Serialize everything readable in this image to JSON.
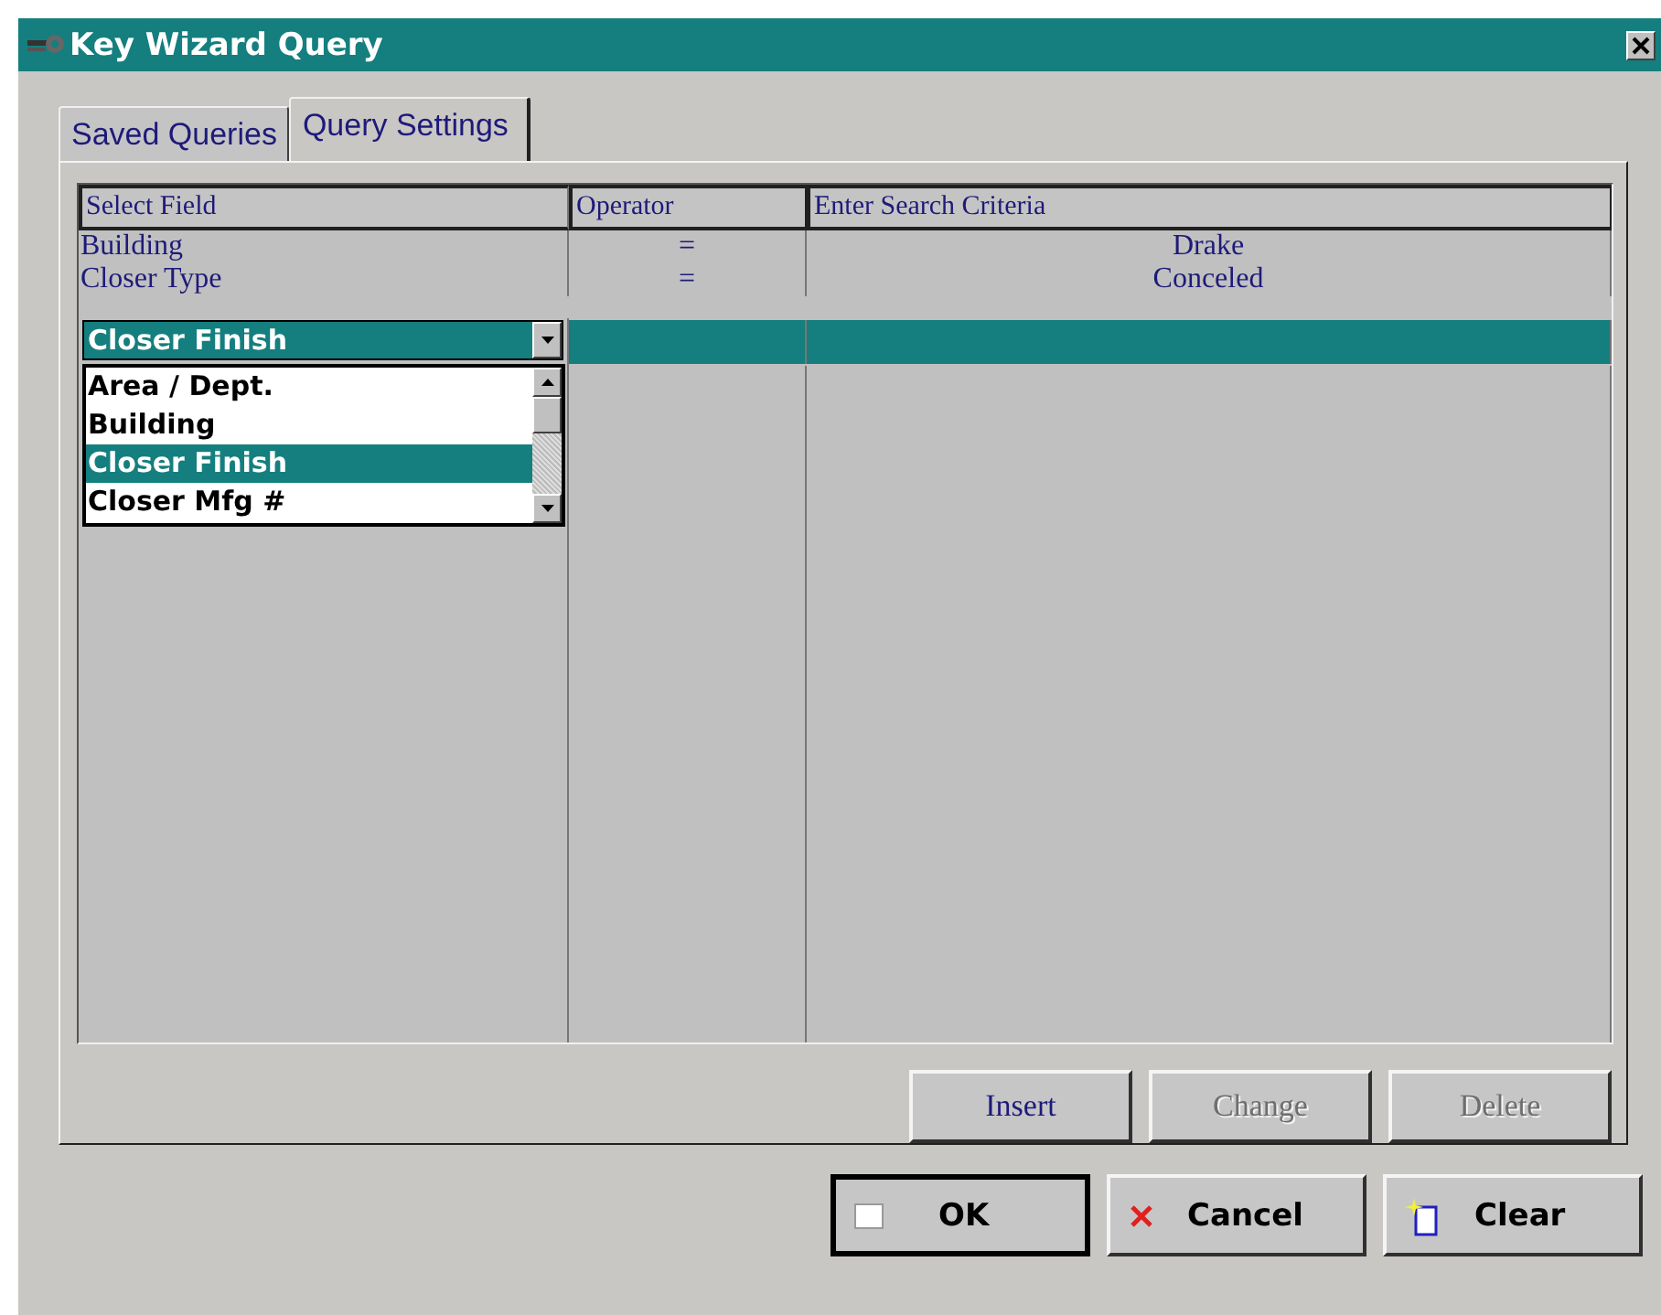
{
  "window": {
    "title": "Key Wizard Query"
  },
  "tabs": [
    {
      "label": "Saved Queries",
      "selected": false
    },
    {
      "label": "Query Settings",
      "selected": true
    }
  ],
  "grid": {
    "columns": [
      "Select Field",
      "Operator",
      "Enter Search Criteria"
    ],
    "rows": [
      {
        "field": "Building",
        "operator": "=",
        "criteria": "Drake"
      },
      {
        "field": "Closer Type",
        "operator": "=",
        "criteria": "Conceled"
      }
    ],
    "editor": {
      "value": "Closer Finish",
      "open": true,
      "options": [
        {
          "label": "Area / Dept.",
          "selected": false
        },
        {
          "label": "Building",
          "selected": false
        },
        {
          "label": "Closer Finish",
          "selected": true
        },
        {
          "label": "Closer Mfg #",
          "selected": false
        }
      ]
    }
  },
  "row_buttons": [
    {
      "label": "Insert",
      "disabled": false
    },
    {
      "label": "Change",
      "disabled": true
    },
    {
      "label": "Delete",
      "disabled": true
    }
  ],
  "dialog_buttons": [
    {
      "kind": "ok",
      "label": "OK"
    },
    {
      "kind": "cancel",
      "label": "Cancel"
    },
    {
      "kind": "clear",
      "label": "Clear"
    }
  ]
}
